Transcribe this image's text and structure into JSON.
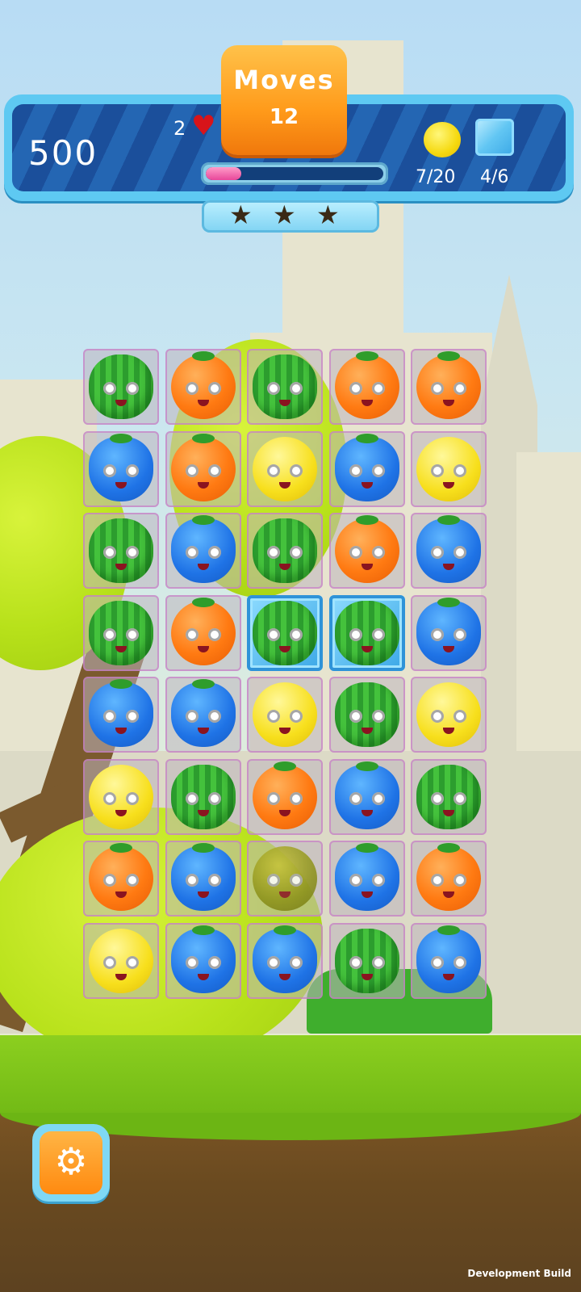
{
  "hud": {
    "score": "500",
    "lives": "2",
    "moves_label": "Moves",
    "moves_value": "12",
    "level_progress": 0.2,
    "goals": [
      {
        "icon": "lemon-icon",
        "count": "7/20"
      },
      {
        "icon": "ice-block-icon",
        "count": "4/6"
      }
    ],
    "stars_earned": 0,
    "stars_total": 3
  },
  "board": {
    "columns": 5,
    "rows": 8,
    "grid": [
      [
        "green",
        "orange",
        "green",
        "orange",
        "orange"
      ],
      [
        "blue",
        "orange",
        "yellow",
        "blue",
        "yellow"
      ],
      [
        "green",
        "blue",
        "green",
        "orange",
        "blue"
      ],
      [
        "green",
        "orange",
        "green",
        "green",
        "blue"
      ],
      [
        "blue",
        "blue",
        "yellow",
        "green",
        "yellow"
      ],
      [
        "yellow",
        "green",
        "orange",
        "blue",
        "green"
      ],
      [
        "orange",
        "blue",
        "dim",
        "blue",
        "orange"
      ],
      [
        "yellow",
        "blue",
        "blue",
        "green",
        "blue"
      ]
    ],
    "iced_cells": [
      [
        3,
        2
      ],
      [
        3,
        3
      ]
    ]
  },
  "settings_icon": "gear-icon",
  "footer": {
    "build_label": "Development Build"
  }
}
